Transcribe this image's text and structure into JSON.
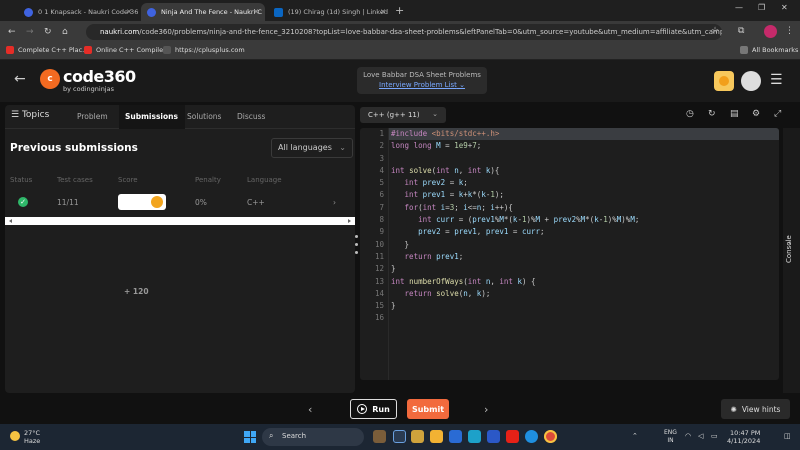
{
  "browser": {
    "tabs": [
      {
        "label": "0 1 Knapsack - Naukri Code 36",
        "color": "#3f63e0"
      },
      {
        "label": "Ninja And The Fence - Naukri C",
        "color": "#3f63e0"
      },
      {
        "label": "(19) Chirag (1d) Singh | Linked",
        "color": "#0a66c2"
      }
    ],
    "url_domain": "naukri.com",
    "url_rest": "/code360/problems/ninja-and-the-fence_3210208?topList=love-babbar-dsa-sheet-problems&leftPanelTab=0&utm_source=youtube&utm_medium=affiliate&utm_campaign=L...",
    "bookmarks": [
      "Complete C++ Plac...",
      "Online C++ Compiler",
      "https://cplusplus.com"
    ],
    "all_bookmarks": "All Bookmarks"
  },
  "header": {
    "logo_text": "code360",
    "logo_sub": "by codingninjas",
    "crumb_title": "Love Babbar DSA Sheet Problems",
    "crumb_link": "Interview Problem List"
  },
  "left": {
    "topics": "Topics",
    "tabs": [
      "Problem",
      "Submissions",
      "Solutions",
      "Discuss"
    ],
    "title": "Previous submissions",
    "filter": "All languages",
    "columns": [
      "Status",
      "Test cases",
      "Score",
      "Penalty",
      "Language"
    ],
    "row": {
      "testcases": "11/11",
      "score": "+ 120",
      "penalty": "0%",
      "language": "C++"
    }
  },
  "editor": {
    "language": "C++ (g++ 11)",
    "lines": [
      "#include <bits/stdc++.h>",
      "long long M = 1e9+7;",
      "",
      "int solve(int n, int k){",
      "   int prev2 = k;",
      "   int prev1 = k+k*(k-1);",
      "   for(int i=3; i<=n; i++){",
      "      int curr = (prev1%M*(k-1)%M + prev2%M*(k-1)%M)%M;",
      "      prev2 = prev1, prev1 = curr;",
      "   }",
      "   return prev1;",
      "}",
      "int numberOfWays(int n, int k) {",
      "   return solve(n, k);",
      "}",
      ""
    ],
    "console": "Console"
  },
  "actions": {
    "run": "Run",
    "submit": "Submit",
    "hints": "View hints"
  },
  "taskbar": {
    "temp": "27°C",
    "weather": "Haze",
    "search": "Search",
    "lang1": "ENG",
    "lang2": "IN",
    "time": "10:47 PM",
    "date": "4/11/2024"
  }
}
